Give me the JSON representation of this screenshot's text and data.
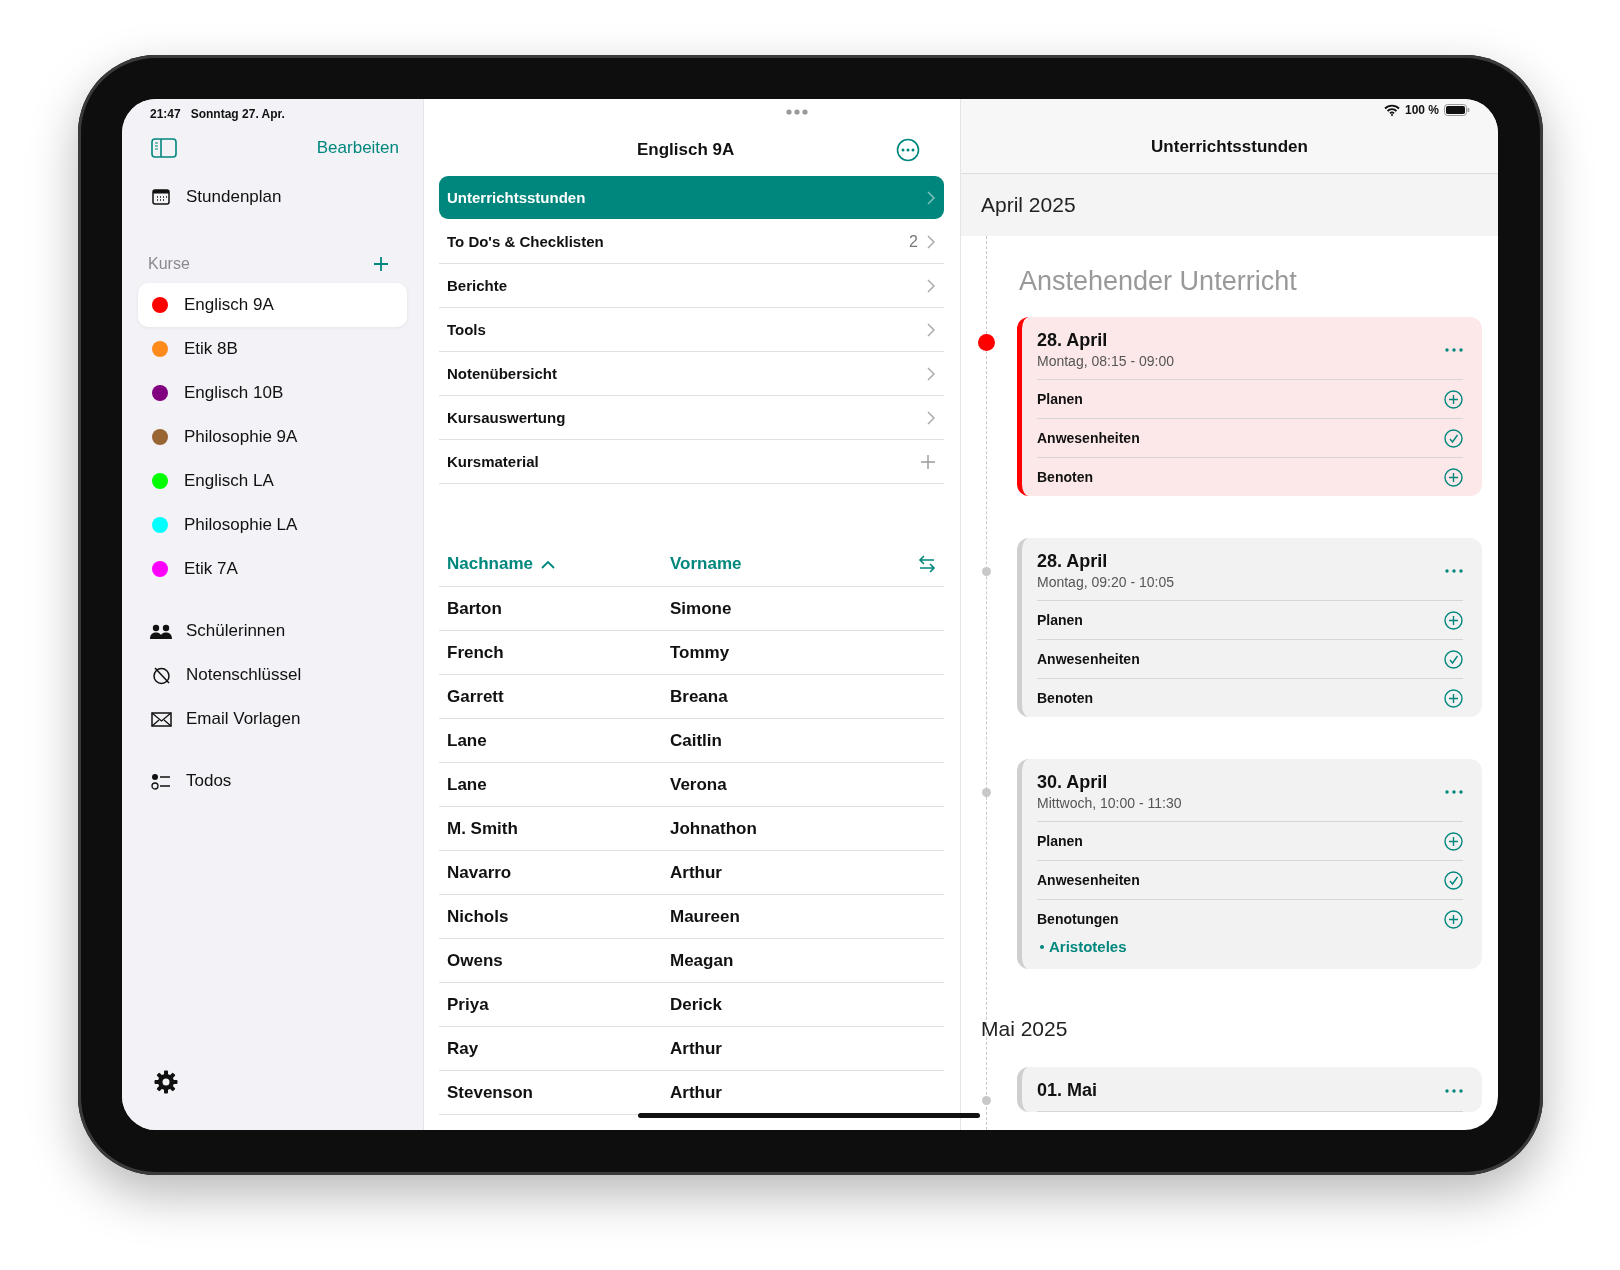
{
  "status_bar": {
    "time": "21:47",
    "date": "Sonntag 27. Apr.",
    "battery": "100 %"
  },
  "sidebar": {
    "edit_label": "Bearbeiten",
    "top_items": [
      {
        "label": "Stundenplan",
        "kind": "calendar"
      }
    ],
    "courses_header": "Kurse",
    "courses": [
      {
        "name": "Englisch 9A",
        "color": "#ff0000",
        "selected": true
      },
      {
        "name": "Etik 8B",
        "color": "#ff8a1c",
        "selected": false
      },
      {
        "name": "Englisch 10B",
        "color": "#800080",
        "selected": false
      },
      {
        "name": "Philosophie 9A",
        "color": "#996633",
        "selected": false
      },
      {
        "name": "Englisch LA",
        "color": "#00ff00",
        "selected": false
      },
      {
        "name": "Philosophie LA",
        "color": "#00ffff",
        "selected": false
      },
      {
        "name": "Etik 7A",
        "color": "#ff00ff",
        "selected": false
      }
    ],
    "nav_groups": [
      [
        {
          "label": "Schülerinnen",
          "kind": "people"
        },
        {
          "label": "Notenschlüssel",
          "kind": "slashed"
        },
        {
          "label": "Email Vorlagen",
          "kind": "mail"
        }
      ],
      [
        {
          "label": "Todos",
          "kind": "todos"
        }
      ]
    ]
  },
  "course": {
    "title": "Englisch 9A",
    "menu": [
      {
        "label": "Unterrichtsstunden",
        "kind": "chevron",
        "selected": true
      },
      {
        "label": "To Do's & Checklisten",
        "count": "2",
        "kind": "chevron",
        "selected": false
      },
      {
        "label": "Berichte",
        "kind": "chevron",
        "selected": false
      },
      {
        "label": "Tools",
        "kind": "chevron",
        "selected": false
      },
      {
        "label": "Notenübersicht",
        "kind": "chevron",
        "selected": false
      },
      {
        "label": "Kursauswertung",
        "kind": "chevron",
        "selected": false
      },
      {
        "label": "Kursmaterial",
        "kind": "plus",
        "selected": false
      }
    ]
  },
  "students": {
    "columns": [
      {
        "label": "Nachname",
        "sorted_ascending": true
      },
      {
        "label": "Vorname"
      }
    ],
    "rows": [
      [
        "Barton",
        "Simone"
      ],
      [
        "French",
        "Tommy"
      ],
      [
        "Garrett",
        "Breana"
      ],
      [
        "Lane",
        "Caitlin"
      ],
      [
        "Lane",
        "Verona"
      ],
      [
        "M. Smith",
        "Johnathon"
      ],
      [
        "Navarro",
        "Arthur"
      ],
      [
        "Nichols",
        "Maureen"
      ],
      [
        "Owens",
        "Meagan"
      ],
      [
        "Priya",
        "Derick"
      ],
      [
        "Ray",
        "Arthur"
      ],
      [
        "Stevenson",
        "Arthur"
      ]
    ]
  },
  "lessons": {
    "title": "Unterrichtsstunden",
    "months": [
      {
        "label": "April 2025",
        "kind": "pinned",
        "section": "Anstehender Unterricht",
        "lessons": [
          {
            "date": "28. April",
            "subtitle": "Montag, 08:15 - 09:00",
            "current": true,
            "items": [
              {
                "label": "Planen",
                "kind": "plus"
              },
              {
                "label": "Anwesenheiten",
                "kind": "check"
              },
              {
                "label": "Benoten",
                "kind": "plus"
              }
            ]
          },
          {
            "date": "28. April",
            "subtitle": "Montag, 09:20 - 10:05",
            "current": false,
            "items": [
              {
                "label": "Planen",
                "kind": "plus"
              },
              {
                "label": "Anwesenheiten",
                "kind": "check"
              },
              {
                "label": "Benoten",
                "kind": "plus"
              }
            ]
          },
          {
            "date": "30. April",
            "subtitle": "Mittwoch, 10:00 - 11:30",
            "current": false,
            "items": [
              {
                "label": "Planen",
                "kind": "plus"
              },
              {
                "label": "Anwesenheiten",
                "kind": "check"
              },
              {
                "label": "Benotungen",
                "kind": "plus",
                "links": [
                  "Aristoteles"
                ]
              }
            ]
          }
        ]
      },
      {
        "label": "Mai 2025",
        "kind": "inline",
        "lessons": [
          {
            "date": "01. Mai",
            "current": false
          }
        ]
      }
    ]
  }
}
